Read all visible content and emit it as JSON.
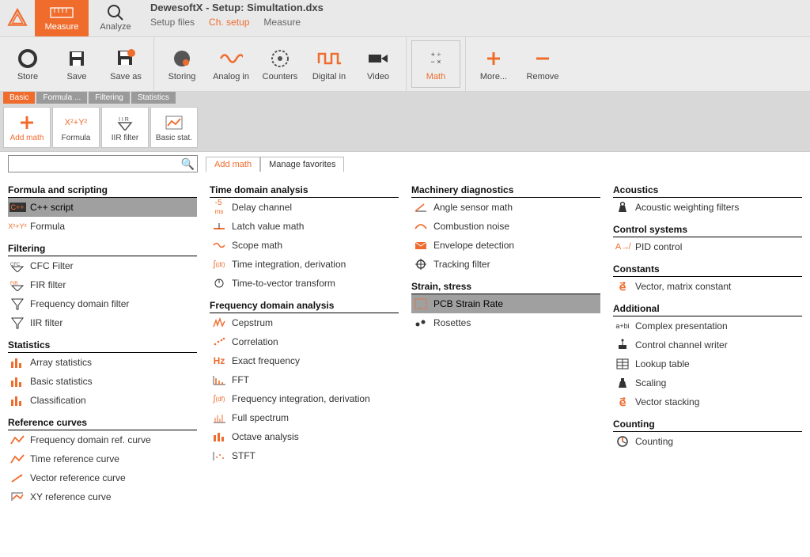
{
  "app_title": "DewesoftX - Setup: Simultation.dxs",
  "top_buttons": {
    "measure": "Measure",
    "analyze": "Analyze"
  },
  "sub_tabs": [
    "Setup files",
    "Ch. setup",
    "Measure"
  ],
  "sub_tab_active": 1,
  "toolbar2": {
    "group1": [
      {
        "id": "store",
        "label": "Store"
      },
      {
        "id": "save",
        "label": "Save"
      },
      {
        "id": "saveas",
        "label": "Save as"
      }
    ],
    "group2": [
      {
        "id": "storing",
        "label": "Storing"
      },
      {
        "id": "analogin",
        "label": "Analog in"
      },
      {
        "id": "counters",
        "label": "Counters"
      },
      {
        "id": "digitalin",
        "label": "Digital in"
      },
      {
        "id": "video",
        "label": "Video"
      }
    ],
    "group3": [
      {
        "id": "math",
        "label": "Math",
        "active": true
      }
    ],
    "group4": [
      {
        "id": "more",
        "label": "More..."
      },
      {
        "id": "remove",
        "label": "Remove"
      }
    ]
  },
  "mini_tabs": [
    "Basic",
    "Formula ...",
    "Filtering",
    "Statistics"
  ],
  "mini_tab_active": 0,
  "shortcuts": [
    {
      "id": "addmath",
      "label": "Add math",
      "active": true
    },
    {
      "id": "formula",
      "label": "Formula"
    },
    {
      "id": "iir",
      "label": "IIR filter"
    },
    {
      "id": "basicstat",
      "label": "Basic stat."
    }
  ],
  "search_placeholder": "",
  "am_tabs": [
    "Add math",
    "Manage favorites"
  ],
  "am_tab_active": 0,
  "columns": [
    [
      {
        "head": "Formula and scripting",
        "items": [
          {
            "icon": "cpp",
            "label": "C++ script",
            "sel": true
          },
          {
            "icon": "xy",
            "label": "Formula"
          }
        ]
      },
      {
        "head": "Filtering",
        "items": [
          {
            "icon": "cfc",
            "label": "CFC Filter"
          },
          {
            "icon": "fir",
            "label": "FIR filter"
          },
          {
            "icon": "funnel",
            "label": "Frequency domain filter"
          },
          {
            "icon": "funnel",
            "label": "IIR filter"
          }
        ]
      },
      {
        "head": "Statistics",
        "items": [
          {
            "icon": "bars",
            "label": "Array statistics"
          },
          {
            "icon": "bars",
            "label": "Basic statistics"
          },
          {
            "icon": "bars",
            "label": "Classification"
          }
        ]
      },
      {
        "head": "Reference curves",
        "items": [
          {
            "icon": "curve",
            "label": "Frequency domain ref. curve"
          },
          {
            "icon": "curve",
            "label": "Time reference curve"
          },
          {
            "icon": "vec",
            "label": "Vector reference curve"
          },
          {
            "icon": "xyref",
            "label": "XY reference curve"
          }
        ]
      }
    ],
    [
      {
        "head": "Time domain analysis",
        "items": [
          {
            "icon": "ms",
            "label": "Delay channel"
          },
          {
            "icon": "latch",
            "label": "Latch value math"
          },
          {
            "icon": "scope",
            "label": "Scope math"
          },
          {
            "icon": "int",
            "label": "Time integration, derivation"
          },
          {
            "icon": "t2v",
            "label": "Time-to-vector transform"
          }
        ]
      },
      {
        "head": "Frequency domain analysis",
        "items": [
          {
            "icon": "cep",
            "label": "Cepstrum"
          },
          {
            "icon": "corr",
            "label": "Correlation"
          },
          {
            "icon": "hz",
            "label": "Exact frequency"
          },
          {
            "icon": "fft",
            "label": "FFT"
          },
          {
            "icon": "intf",
            "label": "Frequency integration, derivation"
          },
          {
            "icon": "full",
            "label": "Full spectrum"
          },
          {
            "icon": "oct",
            "label": "Octave analysis"
          },
          {
            "icon": "stft",
            "label": "STFT"
          }
        ]
      }
    ],
    [
      {
        "head": "Machinery diagnostics",
        "items": [
          {
            "icon": "angle",
            "label": "Angle sensor math"
          },
          {
            "icon": "comb",
            "label": "Combustion noise"
          },
          {
            "icon": "env",
            "label": "Envelope detection"
          },
          {
            "icon": "track",
            "label": "Tracking filter"
          }
        ]
      },
      {
        "head": "Strain, stress",
        "items": [
          {
            "icon": "pcb",
            "label": "PCB Strain Rate",
            "sel": true
          },
          {
            "icon": "ros",
            "label": "Rosettes"
          }
        ]
      }
    ],
    [
      {
        "head": "Acoustics",
        "items": [
          {
            "icon": "weight",
            "label": "Acoustic weighting filters"
          }
        ]
      },
      {
        "head": "Control systems",
        "items": [
          {
            "icon": "pid",
            "label": "PID control"
          }
        ]
      },
      {
        "head": "Constants",
        "items": [
          {
            "icon": "evec",
            "label": "Vector, matrix constant"
          }
        ]
      },
      {
        "head": "Additional",
        "items": [
          {
            "icon": "abi",
            "label": "Complex presentation"
          },
          {
            "icon": "ctrl",
            "label": "Control channel writer"
          },
          {
            "icon": "lut",
            "label": "Lookup table"
          },
          {
            "icon": "scale",
            "label": "Scaling"
          },
          {
            "icon": "stack",
            "label": "Vector stacking"
          }
        ]
      },
      {
        "head": "Counting",
        "items": [
          {
            "icon": "count",
            "label": "Counting"
          }
        ]
      }
    ]
  ]
}
